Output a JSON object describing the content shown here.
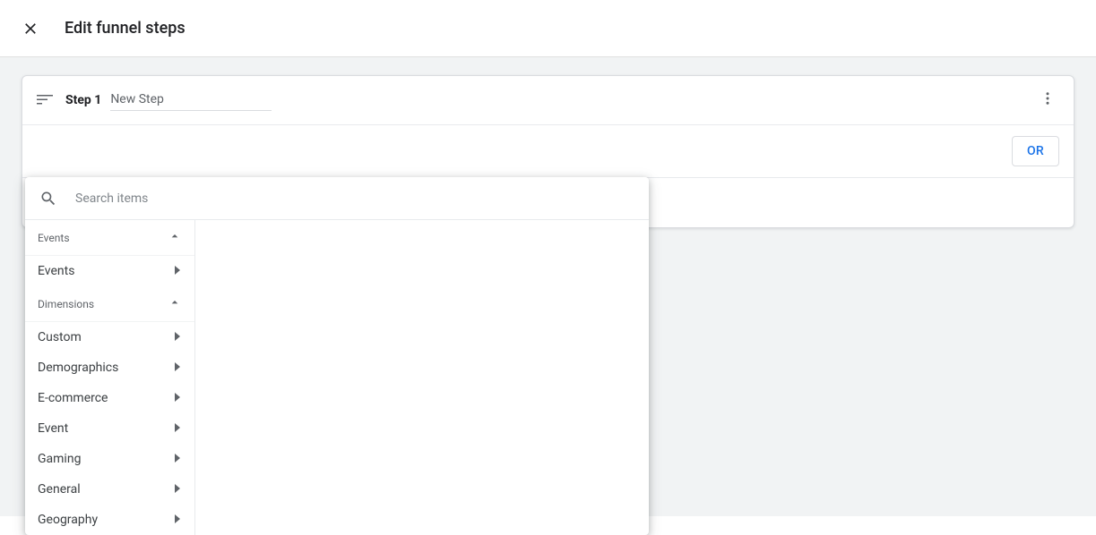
{
  "header": {
    "title": "Edit funnel steps"
  },
  "step": {
    "label": "Step 1",
    "name": "New Step"
  },
  "actions": {
    "or_label": "OR"
  },
  "search": {
    "placeholder": "Search items"
  },
  "sections": [
    {
      "label": "Events",
      "items": [
        {
          "label": "Events"
        }
      ]
    },
    {
      "label": "Dimensions",
      "items": [
        {
          "label": "Custom"
        },
        {
          "label": "Demographics"
        },
        {
          "label": "E-commerce"
        },
        {
          "label": "Event"
        },
        {
          "label": "Gaming"
        },
        {
          "label": "General"
        },
        {
          "label": "Geography"
        }
      ]
    }
  ]
}
